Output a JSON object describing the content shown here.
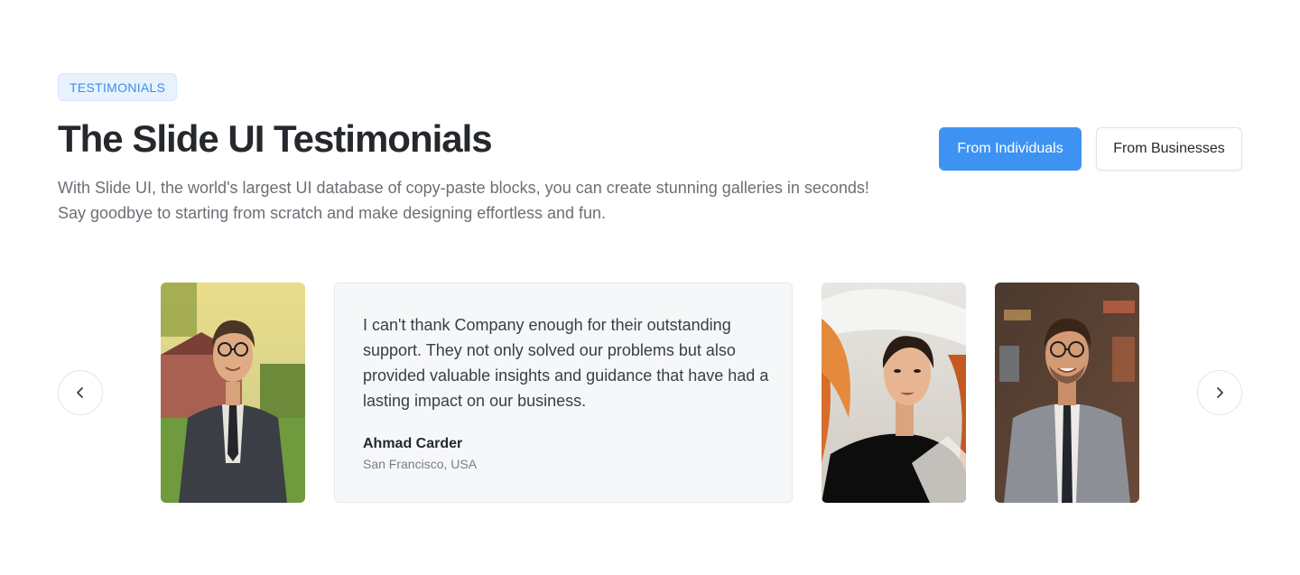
{
  "header": {
    "badge": "TESTIMONIALS",
    "title": "The Slide UI Testimonials",
    "subtitle": "With Slide UI, the world's largest UI database of copy-paste blocks, you can create stunning galleries in seconds! Say goodbye to starting from scratch and make designing effortless and fun."
  },
  "filters": {
    "individuals_label": "From Individuals",
    "businesses_label": "From Businesses",
    "active": "individuals"
  },
  "carousel": {
    "prev_icon": "chevron-left-icon",
    "next_icon": "chevron-right-icon",
    "active_testimonial": {
      "quote": "I can't thank Company enough for their outstanding support. They not only solved our problems but also provided valuable insights and guidance that have had a lasting impact on our business.",
      "name": "Ahmad Carder",
      "location": "San Francisco, USA"
    }
  },
  "colors": {
    "accent": "#3e93f2",
    "badge_bg": "#e8f2fd",
    "badge_text": "#3b8ee8",
    "card_bg": "#f6f7f8"
  }
}
